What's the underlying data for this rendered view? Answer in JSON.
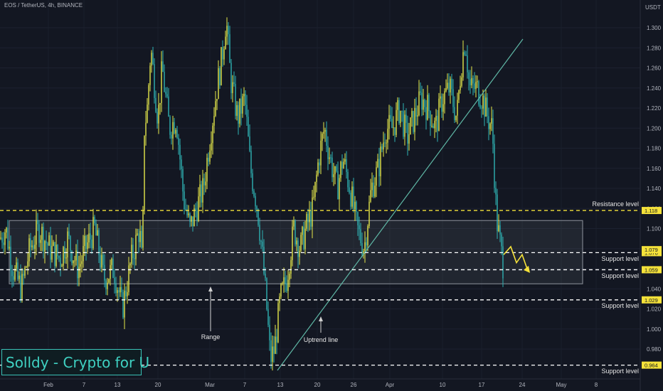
{
  "header": {
    "symbol": "EOS / TetherUS, 4h, BINANCE",
    "currency": "USDT"
  },
  "brand": {
    "label": "Solldy - Crypto for U"
  },
  "colors": {
    "background": "#131722",
    "up": "#e6e84a",
    "down": "#2fb3b4",
    "level_line": "#ffffff",
    "resistance_line": "#f5e23a",
    "trend_line": "#5fb8a6",
    "range_box": "#8f949e",
    "arrow": "#f5e23a",
    "label_tag": "#f5e23a",
    "axis_text": "#b2b5be"
  },
  "chart_data": {
    "type": "candlestick",
    "x_ticks": [
      "Feb",
      "7",
      "13",
      "20",
      "Mar",
      "7",
      "13",
      "20",
      "26",
      "Apr",
      "10",
      "17",
      "24",
      "May",
      "8"
    ],
    "y_ticks": [
      0.98,
      1.0,
      1.02,
      1.04,
      1.06,
      1.08,
      1.1,
      1.12,
      1.14,
      1.16,
      1.18,
      1.2,
      1.22,
      1.24,
      1.26,
      1.28,
      1.3
    ],
    "y_tick_labels": [
      "0.980",
      "1.000",
      "1.020",
      "1.040",
      "1.060",
      "1.080",
      "1.100",
      "1.120",
      "1.140",
      "1.160",
      "1.180",
      "1.200",
      "1.220",
      "1.240",
      "1.260",
      "1.280",
      "1.300"
    ],
    "ylim": [
      0.962,
      1.317
    ],
    "levels": [
      {
        "label": "Resistance level",
        "value": 1.118,
        "tag": "1.118",
        "style": "resistance"
      },
      {
        "label": "Support level",
        "value": 1.076,
        "tag": "1.076",
        "style": "support"
      },
      {
        "label": "Support level",
        "value": 1.059,
        "tag": "1.059",
        "style": "support"
      },
      {
        "label": "Support level",
        "value": 1.029,
        "tag": "1.029",
        "style": "support"
      },
      {
        "label": "Support level",
        "value": 0.964,
        "tag": "0.964",
        "style": "support"
      }
    ],
    "current_price_tag": "1.079",
    "range_box": {
      "label": "Range",
      "top": 1.108,
      "bottom": 1.045
    },
    "trendline": {
      "label": "Uptrend line"
    },
    "candle_key_points": [
      [
        0,
        1.09
      ],
      [
        8,
        1.1
      ],
      [
        18,
        1.06
      ],
      [
        30,
        1.04
      ],
      [
        42,
        1.08
      ],
      [
        55,
        1.1
      ],
      [
        70,
        1.08
      ],
      [
        85,
        1.07
      ],
      [
        95,
        1.09
      ],
      [
        110,
        1.06
      ],
      [
        120,
        1.08
      ],
      [
        133,
        1.1
      ],
      [
        146,
        1.05
      ],
      [
        160,
        1.06
      ],
      [
        172,
        1.02
      ],
      [
        185,
        1.07
      ],
      [
        196,
        1.1
      ],
      [
        200,
        1.06
      ],
      [
        203,
        1.2
      ],
      [
        207,
        1.22
      ],
      [
        212,
        1.28
      ],
      [
        222,
        1.21
      ],
      [
        228,
        1.26
      ],
      [
        238,
        1.2
      ],
      [
        248,
        1.21
      ],
      [
        258,
        1.13
      ],
      [
        267,
        1.1
      ],
      [
        276,
        1.12
      ],
      [
        286,
        1.14
      ],
      [
        295,
        1.19
      ],
      [
        305,
        1.24
      ],
      [
        312,
        1.27
      ],
      [
        318,
        1.31
      ],
      [
        324,
        1.25
      ],
      [
        334,
        1.21
      ],
      [
        344,
        1.23
      ],
      [
        352,
        1.16
      ],
      [
        362,
        1.12
      ],
      [
        368,
        1.08
      ],
      [
        374,
        1.03
      ],
      [
        380,
        0.97
      ],
      [
        386,
        0.98
      ],
      [
        394,
        1.03
      ],
      [
        403,
        1.05
      ],
      [
        413,
        1.1
      ],
      [
        422,
        1.08
      ],
      [
        430,
        1.1
      ],
      [
        440,
        1.12
      ],
      [
        448,
        1.17
      ],
      [
        456,
        1.2
      ],
      [
        464,
        1.17
      ],
      [
        474,
        1.14
      ],
      [
        482,
        1.17
      ],
      [
        492,
        1.14
      ],
      [
        502,
        1.1
      ],
      [
        512,
        1.08
      ],
      [
        522,
        1.14
      ],
      [
        532,
        1.16
      ],
      [
        542,
        1.2
      ],
      [
        552,
        1.2
      ],
      [
        562,
        1.22
      ],
      [
        572,
        1.19
      ],
      [
        582,
        1.21
      ],
      [
        592,
        1.23
      ],
      [
        602,
        1.22
      ],
      [
        612,
        1.2
      ],
      [
        622,
        1.23
      ],
      [
        632,
        1.24
      ],
      [
        642,
        1.21
      ],
      [
        648,
        1.26
      ],
      [
        654,
        1.29
      ],
      [
        660,
        1.24
      ],
      [
        670,
        1.24
      ],
      [
        678,
        1.23
      ],
      [
        686,
        1.21
      ],
      [
        692,
        1.2
      ],
      [
        698,
        1.11
      ],
      [
        704,
        1.08
      ],
      [
        708,
        1.06
      ]
    ],
    "forecast_path": [
      [
        708,
        1.074
      ],
      [
        718,
        1.082
      ],
      [
        726,
        1.066
      ],
      [
        734,
        1.074
      ],
      [
        742,
        1.058
      ]
    ]
  }
}
